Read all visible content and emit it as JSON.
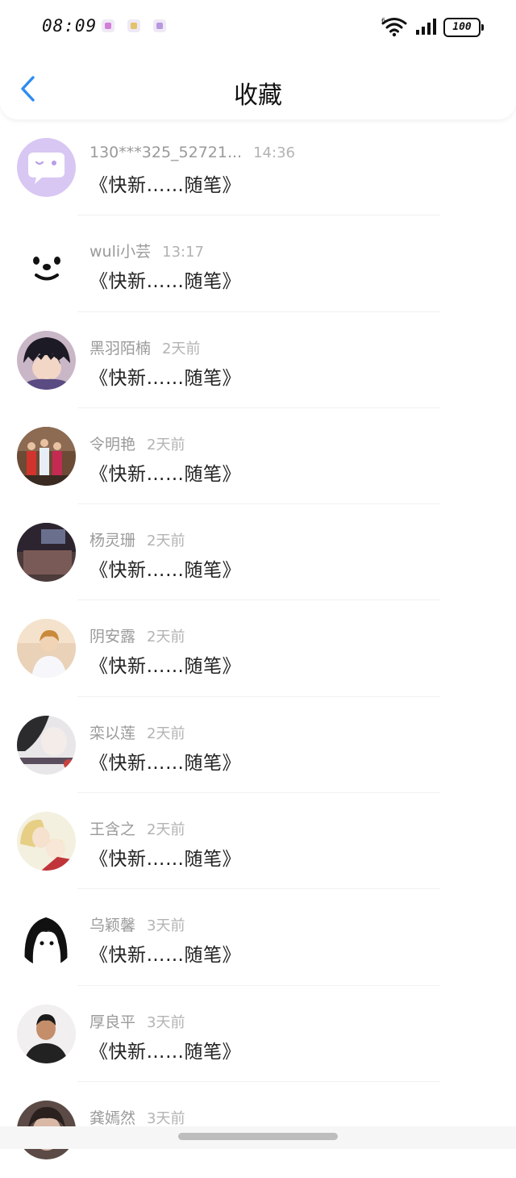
{
  "status_bar": {
    "time": "08:09",
    "battery": "100"
  },
  "header": {
    "title": "收藏",
    "back_icon": "chevron-left-icon"
  },
  "items": [
    {
      "name": "130***325_52721...",
      "time": "14:36",
      "preview": "《快新……随笔》"
    },
    {
      "name": "wuli小芸",
      "time": "13:17",
      "preview": "《快新……随笔》"
    },
    {
      "name": "黑羽陌楠",
      "time": "2天前",
      "preview": "《快新……随笔》"
    },
    {
      "name": "令明艳",
      "time": "2天前",
      "preview": "《快新……随笔》"
    },
    {
      "name": "杨灵珊",
      "time": "2天前",
      "preview": "《快新……随笔》"
    },
    {
      "name": "阴安露",
      "time": "2天前",
      "preview": "《快新……随笔》"
    },
    {
      "name": "栾以莲",
      "time": "2天前",
      "preview": "《快新……随笔》"
    },
    {
      "name": "王含之",
      "time": "2天前",
      "preview": "《快新……随笔》"
    },
    {
      "name": "乌颖馨",
      "time": "3天前",
      "preview": "《快新……随笔》"
    },
    {
      "name": "厚良平",
      "time": "3天前",
      "preview": "《快新……随笔》"
    },
    {
      "name": "龚嫣然",
      "time": "3天前",
      "preview": ""
    }
  ],
  "colors": {
    "accent": "#2d8cf0",
    "title": "#111111",
    "meta": "#9a9a9a"
  }
}
